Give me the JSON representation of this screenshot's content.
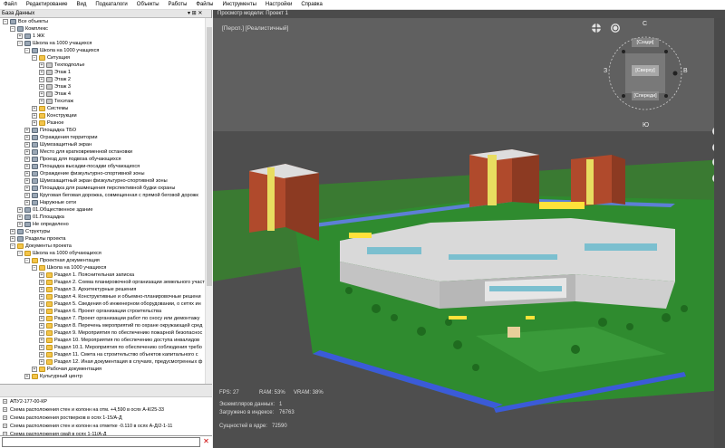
{
  "menu": [
    "Файл",
    "Редактирование",
    "Вид",
    "Подкаталоги",
    "Объекты",
    "Работы",
    "Файлы",
    "Инструменты",
    "Настройки",
    "Справка"
  ],
  "tree_panel": {
    "title": "База Данных",
    "pin": "▾ ⊞ ✕",
    "items": [
      {
        "label": "Все объекты",
        "exp": "−",
        "icon": "ic-obj"
      },
      {
        "label": "Комплекс",
        "exp": "−",
        "icon": "ic-obj"
      },
      {
        "label": "1 ЖК",
        "exp": "+",
        "icon": "ic-obj"
      },
      {
        "label": "Школа на 1000 учащихся",
        "exp": "−",
        "icon": "ic-obj"
      },
      {
        "label": "Школа на 1000 учащихся",
        "exp": "−",
        "icon": "ic-obj"
      },
      {
        "label": "Ситуация",
        "exp": "−",
        "icon": "ic-folder"
      },
      {
        "label": "Техподполье",
        "exp": "+",
        "icon": "ic-floor"
      },
      {
        "label": "Этаж 1",
        "exp": "+",
        "icon": "ic-floor"
      },
      {
        "label": "Этаж 2",
        "exp": "+",
        "icon": "ic-floor"
      },
      {
        "label": "Этаж 3",
        "exp": "+",
        "icon": "ic-floor"
      },
      {
        "label": "Этаж 4",
        "exp": "+",
        "icon": "ic-floor"
      },
      {
        "label": "Техэтаж",
        "exp": "+",
        "icon": "ic-floor"
      },
      {
        "label": "Системы",
        "exp": "+",
        "icon": "ic-folder"
      },
      {
        "label": "Конструкции",
        "exp": "+",
        "icon": "ic-folder"
      },
      {
        "label": "Разное",
        "exp": "+",
        "icon": "ic-folder"
      },
      {
        "label": "Площадка ТБО",
        "exp": "+",
        "icon": "ic-obj"
      },
      {
        "label": "Ограждения территории",
        "exp": "+",
        "icon": "ic-obj"
      },
      {
        "label": "Шумозащитный экран",
        "exp": "+",
        "icon": "ic-obj"
      },
      {
        "label": "Место для кратковременной остановки",
        "exp": "+",
        "icon": "ic-obj"
      },
      {
        "label": "Проезд для подвоза обучающихся",
        "exp": "+",
        "icon": "ic-obj"
      },
      {
        "label": "Площадка высадки-посадки обучающихся",
        "exp": "+",
        "icon": "ic-obj"
      },
      {
        "label": "Ограждение физкультурно-спортивной зоны",
        "exp": "+",
        "icon": "ic-obj"
      },
      {
        "label": "Шумозащитный экран физкультурно-спортивной зоны",
        "exp": "+",
        "icon": "ic-obj"
      },
      {
        "label": "Площадка для размещения перспективной будки охраны",
        "exp": "+",
        "icon": "ic-obj"
      },
      {
        "label": "Круговая беговая дорожка, совмещенная с прямой беговой дорожк",
        "exp": "+",
        "icon": "ic-obj"
      },
      {
        "label": "Наружные сети",
        "exp": "+",
        "icon": "ic-obj"
      },
      {
        "label": "01.Общественное здание",
        "exp": "+",
        "icon": "ic-obj"
      },
      {
        "label": "01.Площадка",
        "exp": "+",
        "icon": "ic-obj"
      },
      {
        "label": "Не определено",
        "exp": "+",
        "icon": "ic-obj"
      },
      {
        "label": "Структуры",
        "exp": "+",
        "icon": "ic-obj"
      },
      {
        "label": "Разделы проекта",
        "exp": "+",
        "icon": "ic-obj"
      },
      {
        "label": "Документы проекта",
        "exp": "−",
        "icon": "ic-folder"
      },
      {
        "label": "Школа на 1000 обучающихся",
        "exp": "−",
        "icon": "ic-folder"
      },
      {
        "label": "Проектная документация",
        "exp": "−",
        "icon": "ic-folder"
      },
      {
        "label": "Школа на 1000 учащихся",
        "exp": "−",
        "icon": "ic-folder"
      },
      {
        "label": "Раздел 1. Пояснительная записка",
        "exp": "+",
        "icon": "ic-folder"
      },
      {
        "label": "Раздел 2. Схема планировочной организации земельного участ",
        "exp": "+",
        "icon": "ic-folder"
      },
      {
        "label": "Раздел 3. Архитектурные решения",
        "exp": "+",
        "icon": "ic-folder"
      },
      {
        "label": "Раздел 4. Конструктивные и объемно-планировочные решени",
        "exp": "+",
        "icon": "ic-folder"
      },
      {
        "label": "Раздел 5. Сведения об инженерном оборудовании, о сетях ин",
        "exp": "+",
        "icon": "ic-folder"
      },
      {
        "label": "Раздел 6. Проект организации строительства",
        "exp": "+",
        "icon": "ic-folder"
      },
      {
        "label": "Раздел 7. Проект организации работ по сносу или демонтажу",
        "exp": "+",
        "icon": "ic-folder"
      },
      {
        "label": "Раздел 8. Перечень мероприятий по охране окружающей сред",
        "exp": "+",
        "icon": "ic-folder"
      },
      {
        "label": "Раздел 9. Мероприятия по обеспечению пожарной безопаснос",
        "exp": "+",
        "icon": "ic-folder"
      },
      {
        "label": "Раздел 10. Мероприятия по обеспечению доступа инвалидов",
        "exp": "+",
        "icon": "ic-folder"
      },
      {
        "label": "Раздел 10.1. Мероприятия по обеспечению соблюдения требо",
        "exp": "+",
        "icon": "ic-folder"
      },
      {
        "label": "Раздел 11. Смета на строительство объектов капитального с",
        "exp": "+",
        "icon": "ic-folder"
      },
      {
        "label": "Раздел 12. Иная документация в случаях, предусмотренных ф",
        "exp": "+",
        "icon": "ic-folder"
      },
      {
        "label": "Рабочая документация",
        "exp": "+",
        "icon": "ic-folder"
      },
      {
        "label": "Культурный центр",
        "exp": "+",
        "icon": "ic-folder"
      }
    ]
  },
  "bottom_list": {
    "items": [
      "АПУ2-177-00-КР",
      "Схема расположения стен и колонн на отм. +4,590 в осях А-К/25-33",
      "Схема расположения ростверков в осях 1-15/А-Д",
      "Схема расположения стен и колонн на отметке -0.110 в осях А-Д/2-1-11",
      "Схема расположения свай в осях 1-11/А-Д"
    ]
  },
  "search": {
    "value": "",
    "placeholder": ""
  },
  "viewport": {
    "title": "Просмотр модели: Проект 1",
    "view_label": "[Персп.] [Реалистичный]",
    "nav": {
      "top": "С",
      "bottom": "Ю",
      "left": "З",
      "right": "В",
      "back": "[Сзади]",
      "top_face": "[Сверху]",
      "front": "[Спереди]"
    },
    "stats": {
      "fps": "FPS: 27",
      "ram": "RAM: 53%",
      "vram": "VRAM: 38%",
      "inst_label": "Экземпляров данных:",
      "inst_val": "1",
      "loaded_label": "Загружено в индексе:",
      "loaded_val": "76763",
      "entities_label": "Сущностей в ядре:",
      "entities_val": "72590"
    }
  },
  "colors": {
    "sky": "#5a5a5a",
    "ground": "#2e8b2e",
    "roof": "#d8d8d8",
    "accent": "#ffe23a",
    "brick": "#b24a2a"
  }
}
